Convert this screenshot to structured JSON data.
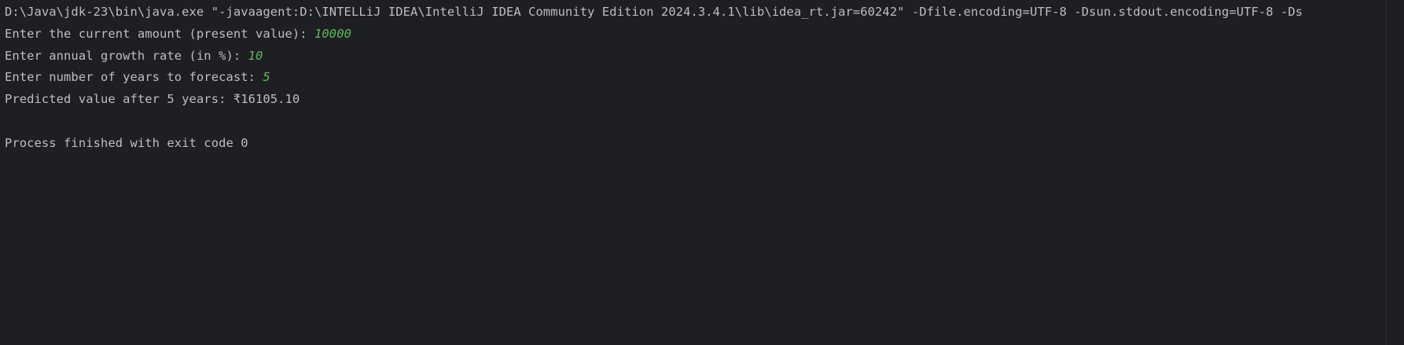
{
  "console": {
    "command_line": "D:\\Java\\jdk-23\\bin\\java.exe \"-javaagent:D:\\INTELLiJ IDEA\\IntelliJ IDEA Community Edition 2024.3.4.1\\lib\\idea_rt.jar=60242\" -Dfile.encoding=UTF-8 -Dsun.stdout.encoding=UTF-8 -Ds",
    "lines": [
      {
        "prompt": "Enter the current amount (present value): ",
        "input": "10000"
      },
      {
        "prompt": "Enter annual growth rate (in %): ",
        "input": "10"
      },
      {
        "prompt": "Enter number of years to forecast: ",
        "input": "5"
      }
    ],
    "result": "Predicted value after 5 years: ₹16105.10",
    "exit_message": "Process finished with exit code 0"
  },
  "colors": {
    "background": "#1e1f22",
    "text": "#bcbec4",
    "user_input": "#5fb760"
  }
}
